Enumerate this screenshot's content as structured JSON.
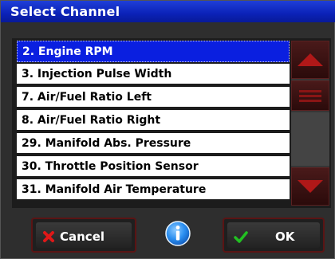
{
  "window": {
    "title": "Select Channel"
  },
  "channel_list": {
    "items": [
      {
        "label": "2. Engine RPM",
        "selected": true
      },
      {
        "label": "3. Injection Pulse Width",
        "selected": false
      },
      {
        "label": "7. Air/Fuel Ratio Left",
        "selected": false
      },
      {
        "label": "8. Air/Fuel Ratio Right",
        "selected": false
      },
      {
        "label": "29. Manifold Abs. Pressure",
        "selected": false
      },
      {
        "label": "30. Throttle Position Sensor",
        "selected": false
      },
      {
        "label": "31. Manifold Air Temperature",
        "selected": false
      }
    ]
  },
  "scrollbar": {
    "up_icon": "arrow-up-icon",
    "down_icon": "arrow-down-icon",
    "thumb_icon": "grip-lines-icon",
    "accent_color": "#b01818"
  },
  "buttons": {
    "cancel_label": "Cancel",
    "cancel_icon": "x-icon",
    "ok_label": "OK",
    "ok_icon": "checkmark-icon",
    "info_icon": "info-icon"
  },
  "colors": {
    "titlebar": "#0b22b8",
    "selected_row": "#0a1fe0",
    "cancel_icon": "#e01818",
    "ok_icon": "#22c022",
    "info_icon": "#2a8ef0"
  }
}
